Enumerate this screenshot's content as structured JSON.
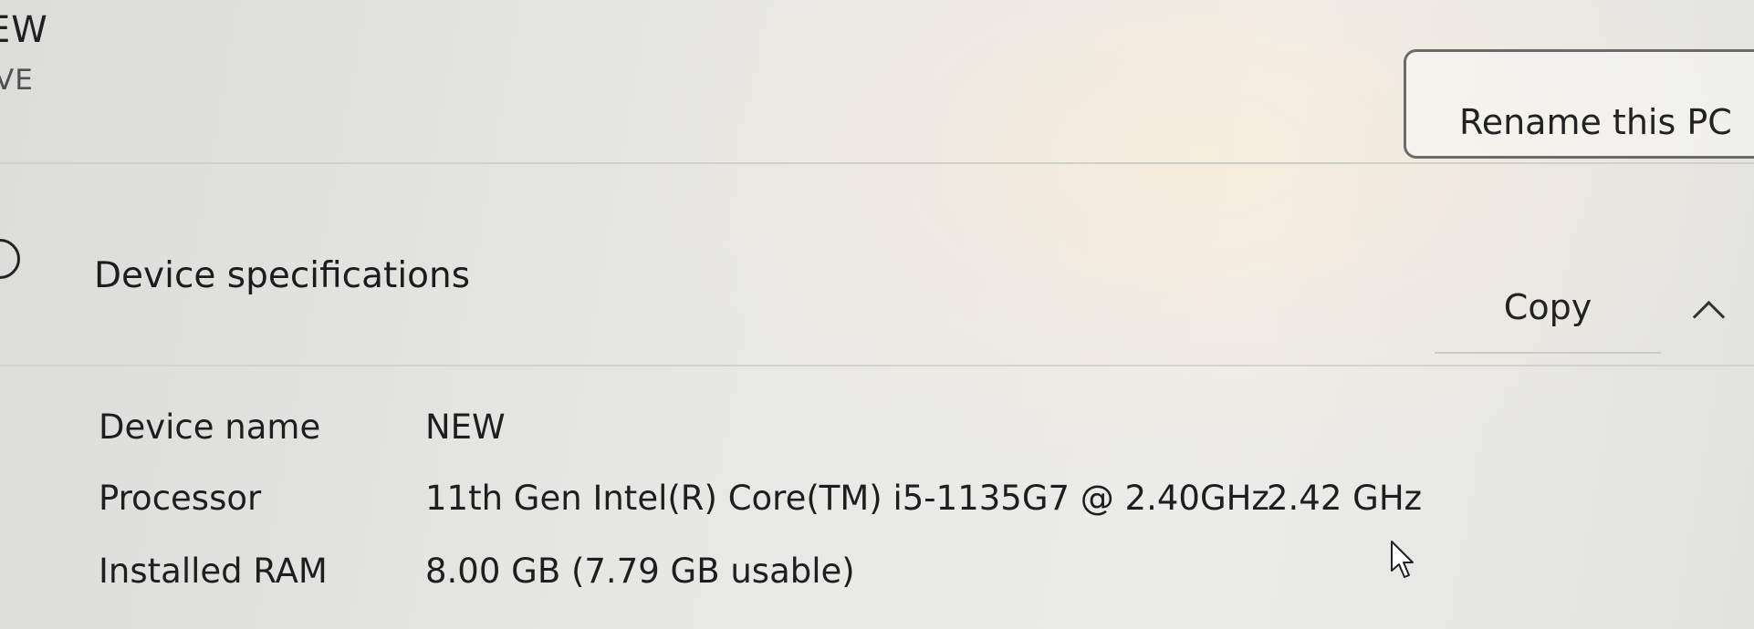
{
  "top_card": {
    "device_name_partial": "EW",
    "device_model_partial": "VE",
    "rename_button_label": "Rename this PC"
  },
  "device_specifications": {
    "title": "Device specifications",
    "copy_button_label": "Copy",
    "rows": [
      {
        "label": "Device name",
        "value": "NEW"
      },
      {
        "label": "Processor",
        "value": "11th Gen Intel(R) Core(TM) i5-1135G7 @ 2.40GHz",
        "extra": "2.42 GHz"
      },
      {
        "label": "Installed RAM",
        "value": "8.00 GB (7.79 GB usable)"
      }
    ]
  },
  "icons": {
    "info": "info-icon",
    "expand": "chevron-up-icon",
    "pointer": "mouse-pointer-icon"
  }
}
